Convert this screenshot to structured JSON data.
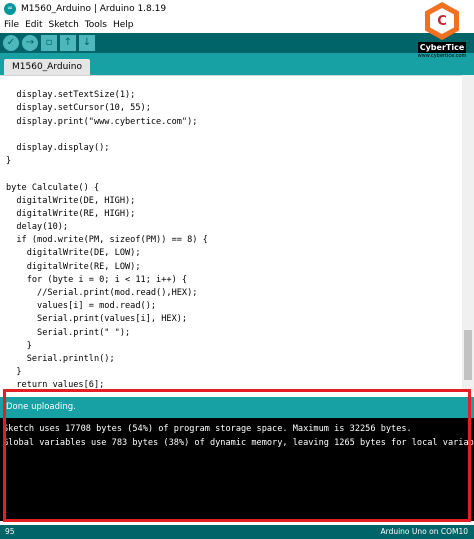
{
  "window": {
    "title": "M1560_Arduino | Arduino 1.8.19",
    "app_icon": "arduino-icon"
  },
  "menu": [
    "File",
    "Edit",
    "Sketch",
    "Tools",
    "Help"
  ],
  "toolbar": {
    "buttons": [
      {
        "name": "verify",
        "icon": "check-icon",
        "glyph": "✓"
      },
      {
        "name": "upload",
        "icon": "arrow-right-icon",
        "glyph": "→"
      },
      {
        "name": "new",
        "icon": "new-file-icon",
        "glyph": "▫"
      },
      {
        "name": "open",
        "icon": "arrow-up-icon",
        "glyph": "↑"
      },
      {
        "name": "save",
        "icon": "arrow-down-icon",
        "glyph": "↓"
      }
    ]
  },
  "tabs": [
    {
      "label": "M1560_Arduino",
      "active": true
    }
  ],
  "brand": {
    "letter": "C",
    "name": "CyberTice",
    "url": "www.cybertice.com"
  },
  "code_lines": [
    "",
    "  display.setTextSize(1);",
    "  display.setCursor(10, 55);",
    "  display.print(\"www.cybertice.com\");",
    "",
    "  display.display();",
    "}",
    "",
    "byte Calculate() {",
    "  digitalWrite(DE, HIGH);",
    "  digitalWrite(RE, HIGH);",
    "  delay(10);",
    "  if (mod.write(PM, sizeof(PM)) == 8) {",
    "    digitalWrite(DE, LOW);",
    "    digitalWrite(RE, LOW);",
    "    for (byte i = 0; i < 11; i++) {",
    "      //Serial.print(mod.read(),HEX);",
    "      values[i] = mod.read();",
    "      Serial.print(values[i], HEX);",
    "      Serial.print(\" \");",
    "    }",
    "    Serial.println();",
    "  }",
    "  return values[6];",
    "}"
  ],
  "status": {
    "message": "Done uploading."
  },
  "console": {
    "lines": [
      "Sketch uses 17708 bytes (54%) of program storage space. Maximum is 32256 bytes.",
      "Global variables use 783 bytes (38%) of dynamic memory, leaving 1265 bytes for local variab"
    ]
  },
  "footer": {
    "line": "95",
    "board": "Arduino Uno on COM10"
  },
  "colors": {
    "teal_dark": "#006468",
    "teal": "#17a1a5",
    "highlight": "#e31e24",
    "brand_orange": "#f37021"
  }
}
